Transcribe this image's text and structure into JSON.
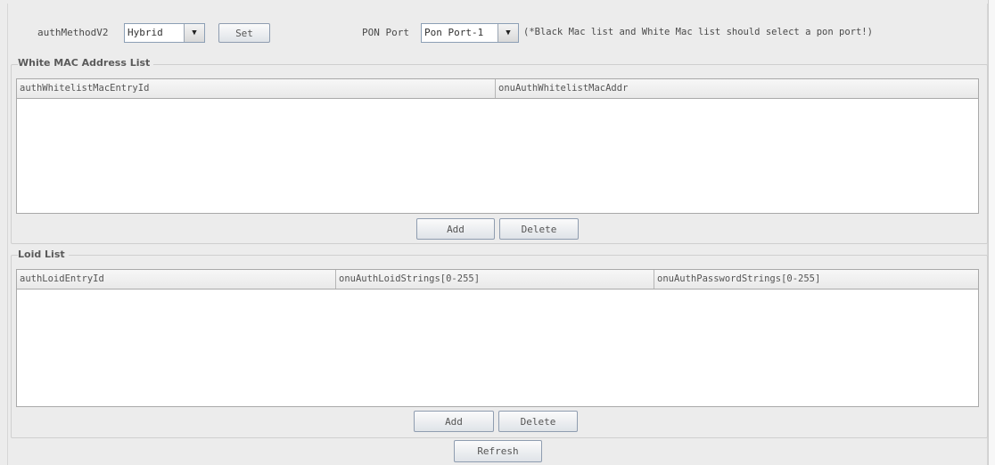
{
  "toolbar": {
    "auth_method_label": "authMethodV2",
    "auth_method_value": "Hybrid",
    "set_label": "Set",
    "pon_port_label": "PON Port",
    "pon_port_value": "Pon Port-1",
    "pon_note": "(*Black Mac list and White Mac list should select a pon port!)"
  },
  "white_list": {
    "title": "White MAC Address List",
    "columns": [
      "authWhitelistMacEntryId",
      "onuAuthWhitelistMacAddr"
    ],
    "add_label": "Add",
    "delete_label": "Delete"
  },
  "loid_list": {
    "title": "Loid List",
    "columns": [
      "authLoidEntryId",
      "onuAuthLoidStrings[0-255]",
      "onuAuthPasswordStrings[0-255]"
    ],
    "add_label": "Add",
    "delete_label": "Delete"
  },
  "refresh_label": "Refresh",
  "icons": {
    "dropdown": "chevron-down-icon"
  }
}
